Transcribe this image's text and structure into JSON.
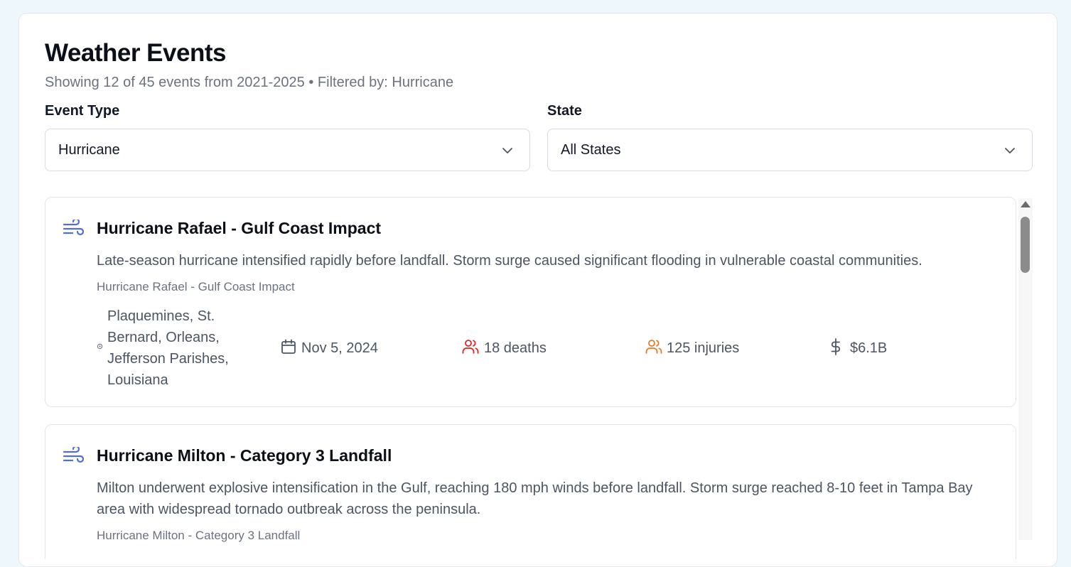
{
  "header": {
    "title": "Weather Events",
    "subtitle": "Showing 12 of 45 events from 2021-2025 • Filtered by: Hurricane"
  },
  "filters": {
    "event_type": {
      "label": "Event Type",
      "value": "Hurricane"
    },
    "state": {
      "label": "State",
      "value": "All States"
    }
  },
  "events": [
    {
      "icon": "wind-icon",
      "title": "Hurricane Rafael - Gulf Coast Impact",
      "description": "Late-season hurricane intensified rapidly before landfall. Storm surge caused significant flooding in vulnerable coastal communities.",
      "source": "Hurricane Rafael - Gulf Coast Impact",
      "location_lines": [
        "Plaquemines, St.",
        "Bernard, Orleans,",
        "Jefferson Parishes,",
        "Louisiana"
      ],
      "date": "Nov 5, 2024",
      "deaths": "18 deaths",
      "injuries": "125 injuries",
      "damage": "$6.1B"
    },
    {
      "icon": "wind-icon",
      "title": "Hurricane Milton - Category 3 Landfall",
      "description": "Milton underwent explosive intensification in the Gulf, reaching 180 mph winds before landfall. Storm surge reached 8-10 feet in Tampa Bay area with widespread tornado outbreak across the peninsula.",
      "source": "Hurricane Milton - Category 3 Landfall"
    }
  ],
  "colors": {
    "wind_icon": "#4f6fd6",
    "deaths_icon": "#dc2626",
    "injuries_icon": "#ea7a2b",
    "muted_text": "#6b7280"
  }
}
